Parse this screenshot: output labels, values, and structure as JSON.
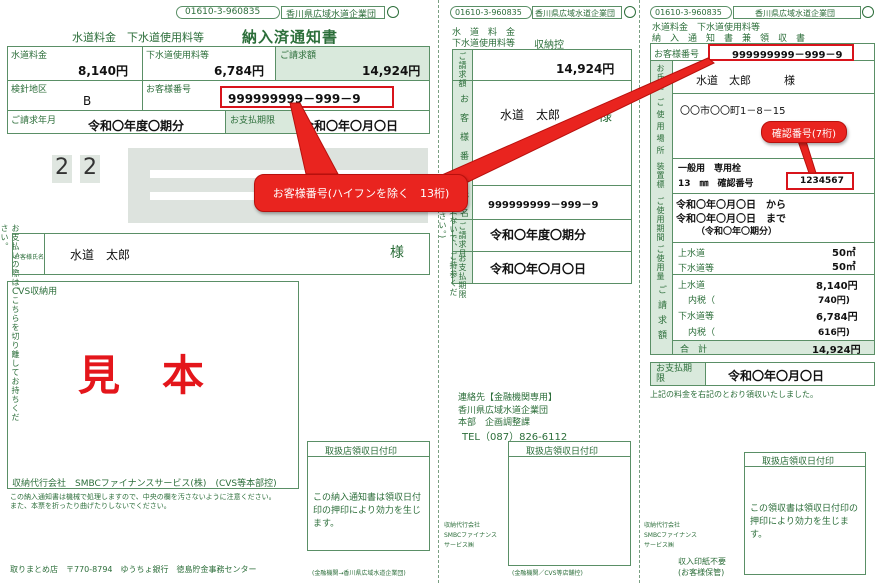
{
  "left": {
    "code": "01610-3-960835",
    "org": "香川県広域水道企業団",
    "sub_title": "水道料金　下水道使用料等",
    "title": "納入済通知書",
    "water_fee_label": "水道料金",
    "water_fee": "8,140円",
    "sewer_fee_label": "下水道使用料等",
    "sewer_fee": "6,784円",
    "billed_label": "ご請求額",
    "billed": "14,924円",
    "district_label": "検針地区",
    "district": "B",
    "customer_no_label": "お客様番号",
    "customer_no": "999999999－999－9",
    "period_label": "ご請求年月",
    "period": "令和〇年度〇期分",
    "due_label": "お支払期限",
    "due": "令和〇年〇月〇日",
    "digits": [
      "2",
      "2"
    ],
    "side_note": "お支払いの際は、こちらを切り離してお持ちください。",
    "name_label": "お客様氏名",
    "name": "水道　太郎",
    "honorific": "様",
    "cvs_label": "CVS収納用",
    "sample": "見　本",
    "agent": "収納代行会社　SMBCファイナンスサービス(株)　(CVS等本部控)",
    "notice_line1": "この納入通知書は機械で処理しますので、中央の欄を汚さないように注意ください。",
    "notice_line2": "また、本票を折ったり曲げたりしないでください。",
    "stamp_title": "取扱店領収日付印",
    "stamp_note": "この納入通知書は領収日付印の押印により効力を生じます。",
    "footer": "取りまとめ店　〒770-8794　ゆうちょ銀行　徳島貯金事務センター"
  },
  "middle": {
    "code": "01610-3-960835",
    "org": "香川県広域水道企業団",
    "sub_title": "水　道　料　金",
    "sub_title2": "下水道使用料等",
    "title": "収納控",
    "billed_label": "ご請求額",
    "billed": "14,924円",
    "customer_label": "お客様番号氏名",
    "name": "水道　太郎",
    "honorific": "様",
    "customer_no": "999999999－999－9",
    "period_label": "ご請求月",
    "period": "令和〇年度〇期分",
    "due_label": "お支払期限",
    "due": "令和〇年〇月〇日",
    "side_note": "(ないで、ご持参ください。)",
    "contact_title": "連絡先【金融機関専用】",
    "contact_org": "香川県広域水道企業団",
    "contact_dept": "本部　企画調整課",
    "contact_tel": "TEL（087）826-6112",
    "stamp_title": "取扱店領収日付印",
    "agent1": "収納代行会社",
    "agent2": "SMBCファイナンス",
    "agent3": "サービス㈱",
    "footer1": "(金融機関→香川県広域水道企業団)",
    "footer2": "(金融機関／CVS等店舗控)"
  },
  "right": {
    "code": "01610-3-960835",
    "org": "香川県広域水道企業団",
    "sub_title": "水道料金　下水道使用料等",
    "title": "納　入　通　知　書　兼　領　収　書",
    "customer_no_label": "お客様番号",
    "customer_no": "999999999－999－9",
    "name_label": "お氏名",
    "name": "水道　太郎　　　様",
    "place_label": "ご使用場所",
    "place": "〇〇市〇〇町1－8－15",
    "device_label": "装置標",
    "device_line1": "一般用　専用栓",
    "device_line2": "13　㎜　確認番号",
    "confirm_no": "1234567",
    "usage_period_label": "ご使用期間",
    "usage_period1": "令和〇年〇月〇日　から",
    "usage_period2": "令和〇年〇月〇日　まで",
    "usage_period3": "（令和〇年〇期分）",
    "usage_label": "ご使用量",
    "water_label": "上水道",
    "water_usage": "50㎥",
    "sewer_label": "下水道等",
    "sewer_usage": "50㎥",
    "bill_label": "ご請求額",
    "water_fee": "8,140円",
    "tax_label": "内税（",
    "water_tax": "740円)",
    "sewer_fee": "6,784円",
    "sewer_tax": "616円)",
    "total_label": "合　計",
    "total": "14,924円",
    "due_label": "お支払期限",
    "due": "令和〇年〇月〇日",
    "receipt_note": "上記の料金を右記のとおり領収いたしました。",
    "stamp_title": "取扱店領収日付印",
    "stamp_note": "この領収書は領収日付印の押印により効力を生じます。",
    "agent1": "収納代行会社",
    "agent2": "SMBCファイナンス",
    "agent3": "サービス㈱",
    "stamp_free": "収入印紙不要",
    "footer": "(お客様保管)"
  },
  "callouts": {
    "customer_no": "お客様番号(ハイフンを除く　13桁)",
    "confirm_no": "確認番号(7桁)"
  },
  "colors": {
    "frame": "#5a8f66",
    "label": "#2c6e3a",
    "accent": "#d8141b",
    "shade": "#d9e9dc"
  }
}
